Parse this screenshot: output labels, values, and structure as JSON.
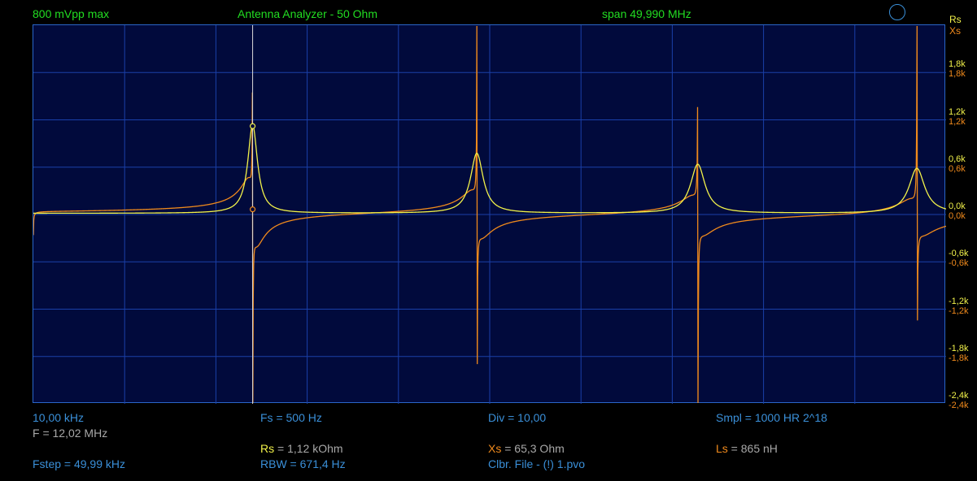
{
  "header": {
    "amplitude": "800 mVpp max",
    "title": "Antenna Analyzer - 50 Ohm",
    "span": "span 49,990 MHz",
    "rs_label": "Rs",
    "xs_label": "Xs"
  },
  "chart_data": {
    "type": "line",
    "title": "Antenna Analyzer - 50 Ohm",
    "xlabel": "",
    "ylabel": "",
    "xlim": [
      0.01,
      50.0
    ],
    "ylim": [
      -2400,
      2400
    ],
    "y_ticks": [
      "1,8k",
      "1,2k",
      "0,6k",
      "0,0k",
      "-0,6k",
      "-1,2k",
      "-1,8k",
      "-2,4k"
    ],
    "grid": true,
    "series": [
      {
        "name": "Rs",
        "color": "#f2f24a",
        "resonances": [
          {
            "f": 12.02,
            "peak": 1120,
            "width": 0.32
          },
          {
            "f": 24.3,
            "peak": 760,
            "width": 0.42
          },
          {
            "f": 36.4,
            "peak": 620,
            "width": 0.48
          },
          {
            "f": 48.4,
            "peak": 570,
            "width": 0.52
          }
        ]
      },
      {
        "name": "Xs",
        "color": "#f08a1c"
      }
    ],
    "cursor": {
      "f": 12.02,
      "Rs": 1120,
      "Xs": 65.3
    }
  },
  "footer": {
    "start_freq": "10,00 kHz",
    "cursor_freq": "F = 12,02 MHz",
    "fstep": "Fstep = 49,99 kHz",
    "fs": "Fs = 500 Hz",
    "rs_name": "Rs",
    "rs_value": " = 1,12 kOhm",
    "rbw": "RBW = 671,4 Hz",
    "div": "Div = 10,00",
    "xs_name": "Xs",
    "xs_value": " = 65,3 Ohm",
    "clbr": "Clbr. File - (!) 1.pvo",
    "smpl": "Smpl = 1000 HR  2^18",
    "ls_name": "Ls",
    "ls_value": " = 865 nH"
  },
  "colors": {
    "background": "#000000",
    "plot_bg": "#010a3c",
    "grid": "#1a3fa8",
    "rs_trace": "#f2f24a",
    "xs_trace": "#f08a1c",
    "header_text": "#22dd22",
    "footer_text": "#3a8fd8"
  },
  "icons": {
    "status": "circle-icon"
  }
}
